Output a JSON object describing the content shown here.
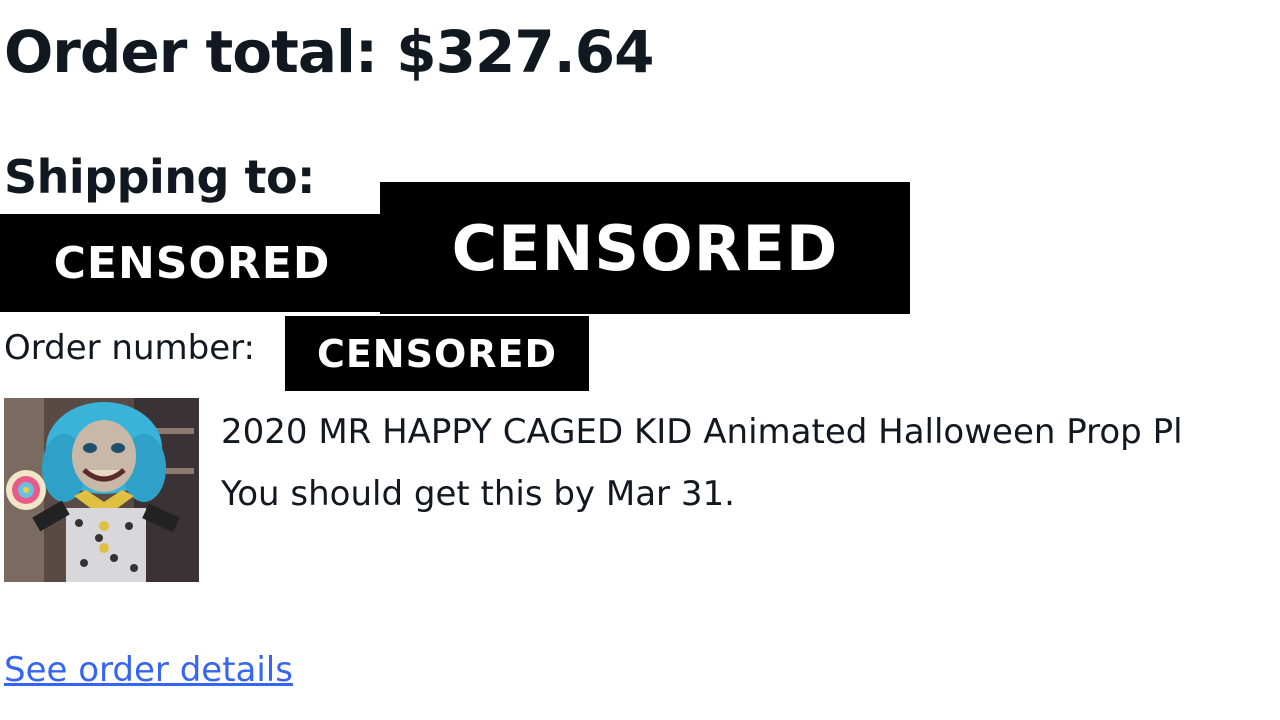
{
  "order": {
    "total_label": "Order total: $327.64",
    "shipping_label": "Shipping to:",
    "censored_name": "CENSORED",
    "censored_address": "CENSORED",
    "order_number_label": "Order number:",
    "censored_order_number": "CENSORED"
  },
  "item": {
    "title": "2020 MR HAPPY CAGED KID Animated Halloween Prop Pl",
    "eta": "You should get this by Mar 31."
  },
  "links": {
    "see_order_details": "See order details"
  },
  "colors": {
    "link": "#3665f3",
    "text": "#111820",
    "censor_bar": "#000000"
  }
}
